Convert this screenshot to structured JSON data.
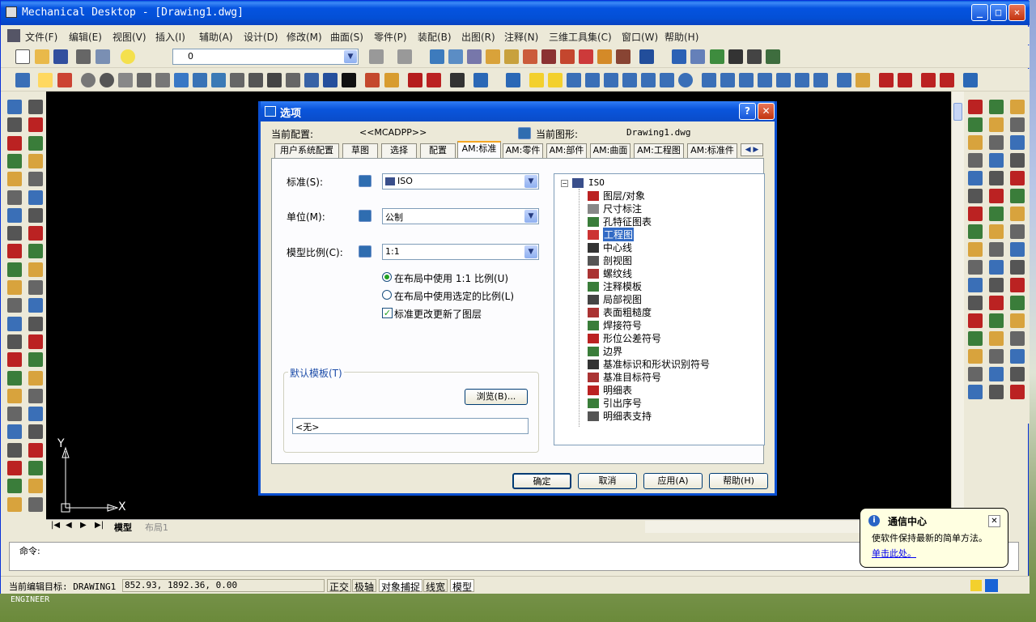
{
  "window": {
    "title": "Mechanical Desktop - [Drawing1.dwg]"
  },
  "menu": [
    "文件(F)",
    "编辑(E)",
    "视图(V)",
    "插入(I)",
    "辅助(A)",
    "设计(D)",
    "修改(M)",
    "曲面(S)",
    "零件(P)",
    "装配(B)",
    "出图(R)",
    "注释(N)",
    "三维工具集(C)",
    "窗口(W)",
    "帮助(H)"
  ],
  "toolbar": {
    "layer_value": "0"
  },
  "canvas": {
    "ucs_x": "X",
    "ucs_y": "Y"
  },
  "layout_tabs": [
    "模型",
    "布局1"
  ],
  "command": {
    "prompt": "命令:"
  },
  "status": {
    "target_label": "当前编辑目标: DRAWING1",
    "coords": "852.93,  1892.36, 0.00",
    "buttons": [
      "正交",
      "极轴",
      "对象捕捉",
      "线宽",
      "模型"
    ]
  },
  "taskbar_label": "ENGINEER",
  "notification": {
    "title": "通信中心",
    "body": "使软件保持最新的简单方法。",
    "link": "单击此处。"
  },
  "dialog": {
    "title": "选项",
    "current_config_label": "当前配置:",
    "current_config_value": "<<MCADPP>>",
    "current_drawing_label": "当前图形:",
    "current_drawing_value": "Drawing1.dwg",
    "tabs": [
      "用户系统配置",
      "草图",
      "选择",
      "配置",
      "AM:标准",
      "AM:零件",
      "AM:部件",
      "AM:曲面",
      "AM:工程图",
      "AM:标准件"
    ],
    "active_tab": "AM:标准",
    "standard_label": "标准(S):",
    "standard_value": "ISO",
    "units_label": "单位(M):",
    "units_value": "公制",
    "scale_label": "模型比例(C):",
    "scale_value": "1:1",
    "radio1": "在布局中使用 1:1 比例(U)",
    "radio2": "在布局中使用选定的比例(L)",
    "checkbox": "标准更改更新了图层",
    "template_group": "默认模板(T)",
    "browse_button": "浏览(B)...",
    "template_value": "<无>",
    "tree_root": "ISO",
    "tree_items": [
      "图层/对象",
      "尺寸标注",
      "孔特征图表",
      "工程图",
      "中心线",
      "剖视图",
      "螺纹线",
      "注释模板",
      "局部视图",
      "表面粗糙度",
      "焊接符号",
      "形位公差符号",
      "边界",
      "基准标识和形状识别符号",
      "基准目标符号",
      "明细表",
      "引出序号",
      "明细表支持"
    ],
    "tree_selected": "工程图",
    "ok": "确定",
    "cancel": "取消",
    "apply": "应用(A)",
    "help": "帮助(H)"
  }
}
